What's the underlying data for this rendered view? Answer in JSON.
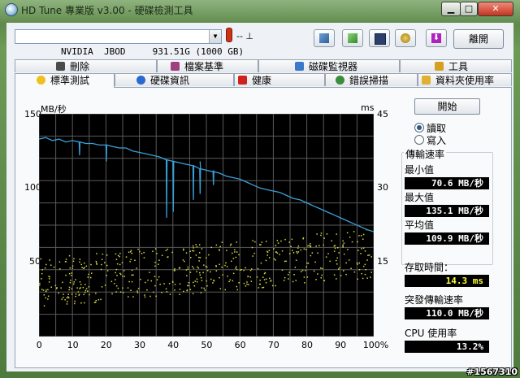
{
  "window": {
    "title": "HD Tune 專業版 v3.00 - 硬碟檢測工具"
  },
  "toolbar": {
    "drive": "NVIDIA  JBOD     931.51G (1000 GB)",
    "temperature": "-- ⊥",
    "exit_label": "離開"
  },
  "tabs_top": [
    "刪除",
    "檔案基準",
    "磁碟監視器",
    "工具"
  ],
  "tabs_bottom": [
    "標準測試",
    "硬碟資訊",
    "健康",
    "錯誤掃描",
    "資料夾使用率"
  ],
  "chart_data": {
    "type": "line",
    "ylabel_left": "MB/秒",
    "ylabel_right": "ms",
    "ylim_left": [
      0,
      150
    ],
    "ylim_right": [
      0,
      45
    ],
    "yticks_left": [
      "150",
      "100",
      "50"
    ],
    "yticks_right": [
      "45",
      "30",
      "15"
    ],
    "xticks": [
      "0",
      "10",
      "20",
      "30",
      "40",
      "50",
      "60",
      "70",
      "80",
      "90",
      "100%"
    ],
    "xlim": [
      0,
      100
    ],
    "grid": true,
    "series": [
      {
        "color": "#3aa0d8",
        "x": [
          0,
          2,
          4,
          6,
          8,
          10,
          12,
          14,
          16,
          18,
          20,
          22,
          24,
          26,
          28,
          30,
          32,
          34,
          36,
          38,
          40,
          42,
          44,
          46,
          48,
          50,
          52,
          54,
          56,
          58,
          60,
          62,
          64,
          66,
          68,
          70,
          72,
          74,
          76,
          78,
          80,
          82,
          84,
          86,
          88,
          90,
          92,
          94,
          96,
          98,
          100
        ],
        "y": [
          133,
          134,
          132,
          133,
          131,
          132,
          131,
          130,
          130,
          129,
          129,
          128,
          127,
          127,
          125,
          124,
          123,
          122,
          121,
          119,
          118,
          117,
          116,
          115,
          113,
          112,
          111,
          110,
          108,
          107,
          106,
          104,
          102,
          100,
          99,
          98,
          97,
          95,
          93,
          92,
          90,
          88,
          86,
          84,
          82,
          80,
          78,
          76,
          74,
          72,
          70.6
        ]
      },
      {
        "color": "#d8d840",
        "type": "scatter",
        "label": "access time (ms)",
        "y_range_ms": [
          6,
          22
        ]
      }
    ]
  },
  "controls": {
    "start_label": "開始",
    "read_label": "讀取",
    "write_label": "寫入"
  },
  "stats": {
    "transfer_label": "傳輸速率",
    "min_label": "最小值",
    "min_value": "70.6 MB/秒",
    "max_label": "最大值",
    "max_value": "135.1 MB/秒",
    "avg_label": "平均值",
    "avg_value": "109.9 MB/秒",
    "access_label": "存取時間：",
    "access_value": "14.3 ms",
    "burst_label": "突發傳輸速率",
    "burst_value": "110.0 MB/秒",
    "cpu_label": "CPU 使用率",
    "cpu_value": "13.2%"
  },
  "watermark": "#1567310"
}
